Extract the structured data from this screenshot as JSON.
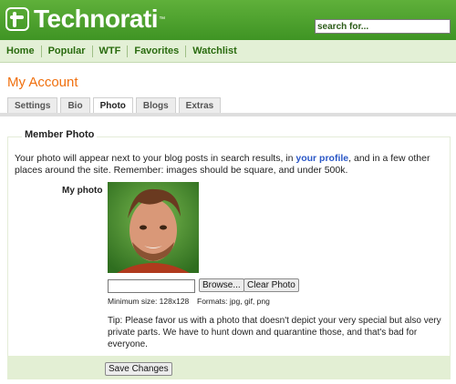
{
  "header": {
    "logo_text": "Technorati",
    "trademark": "™",
    "search_placeholder": "search for..."
  },
  "nav": [
    "Home",
    "Popular",
    "WTF",
    "Favorites",
    "Watchlist"
  ],
  "page_title": "My Account",
  "tabs": [
    "Settings",
    "Bio",
    "Photo",
    "Blogs",
    "Extras"
  ],
  "active_tab": "Photo",
  "section": {
    "legend": "Member Photo",
    "intro_before": "Your photo will appear next to your blog posts in search results, in ",
    "intro_link": "your profile",
    "intro_after": ", and in a few other places around the site. Remember: images should be square, and under 500k.",
    "photo_label": "My photo",
    "browse_label": "Browse...",
    "clear_label": "Clear Photo",
    "min_size": "Minimum size: 128x128",
    "formats": "Formats: jpg, gif, png",
    "tip": "Tip: Please favor us with a photo that doesn't depict your very special but also very private parts. We have to hunt down and quarantine those, and that's bad for everyone."
  },
  "save_label": "Save Changes",
  "colors": {
    "brand_green": "#4ca02f",
    "accent_orange": "#f0700f",
    "link_blue": "#2a57c6"
  }
}
